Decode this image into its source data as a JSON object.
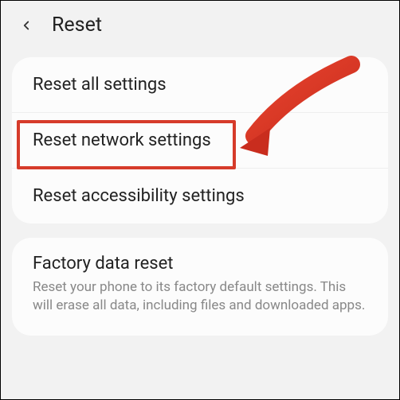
{
  "header": {
    "title": "Reset"
  },
  "group1": {
    "items": [
      {
        "label": "Reset all settings"
      },
      {
        "label": "Reset network settings"
      },
      {
        "label": "Reset accessibility settings"
      }
    ]
  },
  "group2": {
    "items": [
      {
        "label": "Factory data reset",
        "description": "Reset your phone to its factory default settings. This will erase all data, including files and downloaded apps."
      }
    ]
  },
  "highlight": {
    "color": "#d63b2a"
  }
}
